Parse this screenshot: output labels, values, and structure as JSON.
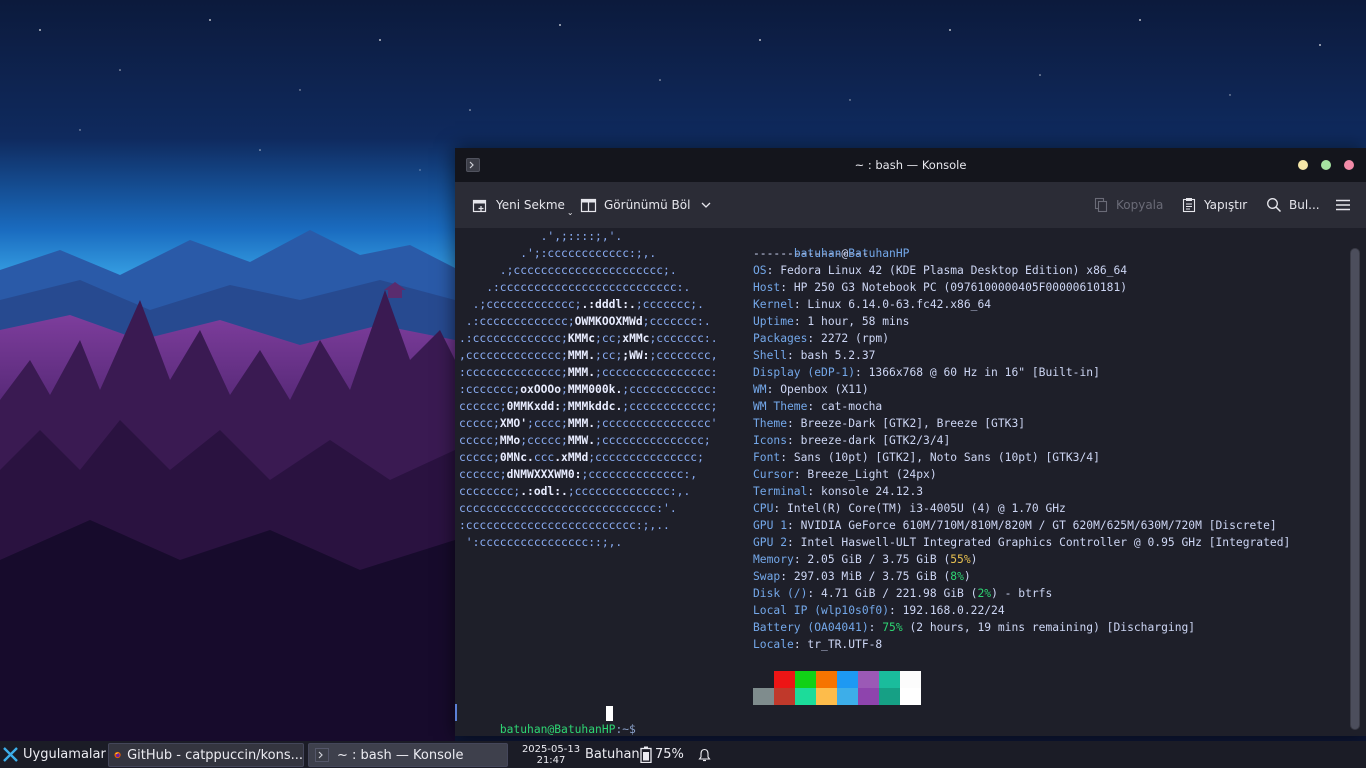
{
  "colors": {
    "accent": "#74a8ea",
    "logo": "#8aadf4",
    "prompt_user": "#2ed573",
    "window_bg": "#1e1f29"
  },
  "window": {
    "title": "~ : bash — Konsole",
    "controls": [
      "minimize-icon",
      "maximize-icon",
      "close-icon"
    ]
  },
  "toolbar": {
    "new_tab": "Yeni Sekme",
    "split_view": "Görünümü Böl",
    "copy": "Kopyala",
    "paste": "Yapıştır",
    "find": "Bul...",
    "menu_icon": "hamburger-menu-icon"
  },
  "terminal": {
    "logo": [
      [
        {
          "t": "            .',;::::;,'."
        }
      ],
      [
        {
          "t": "         .';:cccccccccccc:;,."
        }
      ],
      [
        {
          "t": "      .;cccccccccccccccccccccc;."
        }
      ],
      [
        {
          "t": "    .:cccccccccccccccccccccccccc:."
        }
      ],
      [
        {
          "t": "  .;ccccccccccccc;"
        },
        {
          "t": ".:dddl:.",
          "b": 1
        },
        {
          "t": ";ccccccc;."
        }
      ],
      [
        {
          "t": " .:ccccccccccccc;"
        },
        {
          "t": "OWMKOOXMWd",
          "b": 1
        },
        {
          "t": ";ccccccc:."
        }
      ],
      [
        {
          "t": ".:ccccccccccccc;"
        },
        {
          "t": "KMMc",
          "b": 1
        },
        {
          "t": ";cc;"
        },
        {
          "t": "xMMc",
          "b": 1
        },
        {
          "t": ";ccccccc:."
        }
      ],
      [
        {
          "t": ",cccccccccccccc;"
        },
        {
          "t": "MMM.",
          "b": 1
        },
        {
          "t": ";cc;"
        },
        {
          "t": ";WW:",
          "b": 1
        },
        {
          "t": ";cccccccc,"
        }
      ],
      [
        {
          "t": ":cccccccccccccc;"
        },
        {
          "t": "MMM.",
          "b": 1
        },
        {
          "t": ";cccccccccccccccc:"
        }
      ],
      [
        {
          "t": ":ccccccc;"
        },
        {
          "t": "oxOOOo",
          "b": 1
        },
        {
          "t": ";"
        },
        {
          "t": "MMM000k.",
          "b": 1
        },
        {
          "t": ";cccccccccccc:"
        }
      ],
      [
        {
          "t": "cccccc;"
        },
        {
          "t": "0MMKxdd:",
          "b": 1
        },
        {
          "t": ";"
        },
        {
          "t": "MMMkddc.",
          "b": 1
        },
        {
          "t": ";cccccccccccc;"
        }
      ],
      [
        {
          "t": "ccccc;"
        },
        {
          "t": "XMO'",
          "b": 1
        },
        {
          "t": ";cccc;"
        },
        {
          "t": "MMM.",
          "b": 1
        },
        {
          "t": ";cccccccccccccccc'"
        }
      ],
      [
        {
          "t": "ccccc;"
        },
        {
          "t": "MMo",
          "b": 1
        },
        {
          "t": ";ccccc;"
        },
        {
          "t": "MMW.",
          "b": 1
        },
        {
          "t": ";ccccccccccccccc;"
        }
      ],
      [
        {
          "t": "ccccc;"
        },
        {
          "t": "0MNc.",
          "b": 1
        },
        {
          "t": "ccc"
        },
        {
          "t": ".xMMd",
          "b": 1
        },
        {
          "t": ";ccccccccccccccc;"
        }
      ],
      [
        {
          "t": "cccccc;"
        },
        {
          "t": "dNMWXXXWM0:",
          "b": 1
        },
        {
          "t": ";cccccccccccccc:,"
        }
      ],
      [
        {
          "t": "cccccccc;"
        },
        {
          "t": ".:odl:.",
          "b": 1
        },
        {
          "t": ";cccccccccccccc:,."
        }
      ],
      [
        {
          "t": "ccccccccccccccccccccccccccccc:'."
        }
      ],
      [
        {
          "t": ":ccccccccccccccccccccccccc:;,.."
        }
      ],
      [
        {
          "t": " ':cccccccccccccccc::;,."
        }
      ]
    ],
    "user": "batuhan",
    "at": "@",
    "host": "BatuhanHP",
    "separator": "-----------------",
    "info": [
      {
        "key": "OS",
        "value": "Fedora Linux 42 (KDE Plasma Desktop Edition) x86_64"
      },
      {
        "key": "Host",
        "value": "HP 250 G3 Notebook PC (0976100000405F00000610181)"
      },
      {
        "key": "Kernel",
        "value": "Linux 6.14.0-63.fc42.x86_64"
      },
      {
        "key": "Uptime",
        "value": "1 hour, 58 mins"
      },
      {
        "key": "Packages",
        "value": "2272 (rpm)"
      },
      {
        "key": "Shell",
        "value": "bash 5.2.37"
      },
      {
        "key": "Display (eDP-1)",
        "value": "1366x768 @ 60 Hz in 16\" [Built-in]"
      },
      {
        "key": "WM",
        "value": "Openbox (X11)"
      },
      {
        "key": "WM Theme",
        "value": "cat-mocha"
      },
      {
        "key": "Theme",
        "value": "Breeze-Dark [GTK2], Breeze [GTK3]"
      },
      {
        "key": "Icons",
        "value": "breeze-dark [GTK2/3/4]"
      },
      {
        "key": "Font",
        "value": "Sans (10pt) [GTK2], Noto Sans (10pt) [GTK3/4]"
      },
      {
        "key": "Cursor",
        "value": "Breeze_Light (24px)"
      },
      {
        "key": "Terminal",
        "value": "konsole 24.12.3"
      },
      {
        "key": "CPU",
        "value": "Intel(R) Core(TM) i3-4005U (4) @ 1.70 GHz"
      },
      {
        "key": "GPU 1",
        "value": "NVIDIA GeForce 610M/710M/810M/820M / GT 620M/625M/630M/720M [Discrete]"
      },
      {
        "key": "GPU 2",
        "value": "Intel Haswell-ULT Integrated Graphics Controller @ 0.95 GHz [Integrated]"
      },
      {
        "key": "Memory",
        "value": "2.05 GiB / 3.75 GiB (",
        "pct": "55%",
        "pct_color": "yellow",
        "after": ")"
      },
      {
        "key": "Swap",
        "value": "297.03 MiB / 3.75 GiB (",
        "pct": "8%",
        "pct_color": "green",
        "after": ")"
      },
      {
        "key": "Disk (/)",
        "value": "4.71 GiB / 221.98 GiB (",
        "pct": "2%",
        "pct_color": "green",
        "after": ") - btrfs"
      },
      {
        "key": "Local IP (wlp10s0f0)",
        "value": "192.168.0.22/24"
      },
      {
        "key": "Battery (OA04041)",
        "value": "",
        "pct": "75%",
        "pct_color": "green",
        "after": " (2 hours, 19 mins remaining) [Discharging]"
      },
      {
        "key": "Locale",
        "value": "tr_TR.UTF-8"
      }
    ],
    "palette_top": [
      "#1e1f29",
      "#ed1515",
      "#11d116",
      "#f67400",
      "#1d99f3",
      "#9b59b6",
      "#1abc9c",
      "#fcfcfc"
    ],
    "palette_bottom": [
      "#7f8c8d",
      "#c0392b",
      "#1cdc9a",
      "#fdbc4b",
      "#3daee9",
      "#8e44ad",
      "#16a085",
      "#ffffff"
    ],
    "prompt_user": "batuhan@BatuhanHP",
    "prompt_rest": ":~$ "
  },
  "panel": {
    "launcher": "Uygulamalar",
    "tasks": [
      {
        "label": "GitHub - catppuccin/kons...",
        "icon": "firefox-icon"
      },
      {
        "label": "~ : bash — Konsole",
        "icon": "konsole-icon"
      }
    ],
    "date": "2025-05-13",
    "time": "21:47",
    "user": "Batuhan",
    "battery": "75%",
    "notifications_icon": "bell-icon"
  }
}
